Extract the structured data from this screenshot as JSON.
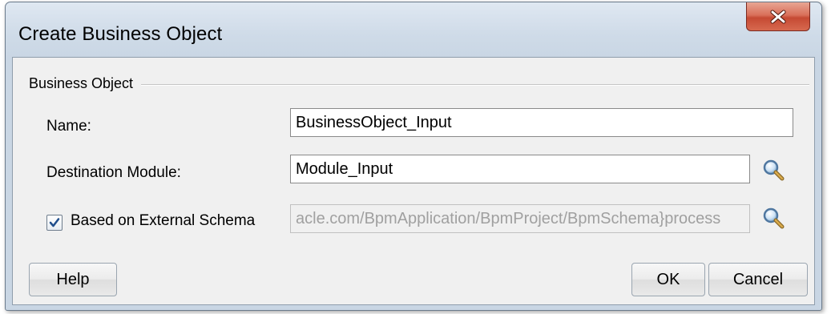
{
  "dialog": {
    "title": "Create Business Object",
    "close_icon": "close-x-icon"
  },
  "group": {
    "legend": "Business Object"
  },
  "fields": {
    "name": {
      "label": "Name:",
      "value": "BusinessObject_Input"
    },
    "destination_module": {
      "label": "Destination Module:",
      "value": "Module_Input",
      "browse_icon": "magnifier-icon"
    },
    "external_schema": {
      "label": "Based on External Schema",
      "checked": true,
      "value": "acle.com/BpmApplication/BpmProject/BpmSchema}process",
      "browse_icon": "magnifier-icon"
    }
  },
  "buttons": {
    "help": "Help",
    "ok": "OK",
    "cancel": "Cancel"
  },
  "colors": {
    "close_button": "#c64a33",
    "disabled_text": "#a0a0a0"
  }
}
